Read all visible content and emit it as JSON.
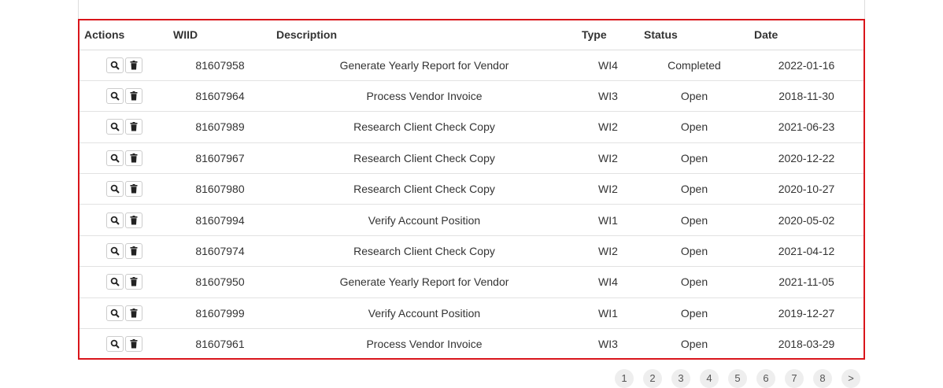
{
  "table": {
    "columns": [
      "Actions",
      "WIID",
      "Description",
      "Type",
      "Status",
      "Date"
    ],
    "rows": [
      {
        "wiid": "81607958",
        "description": "Generate Yearly Report for Vendor",
        "type": "WI4",
        "status": "Completed",
        "date": "2022-01-16"
      },
      {
        "wiid": "81607964",
        "description": "Process Vendor Invoice",
        "type": "WI3",
        "status": "Open",
        "date": "2018-11-30"
      },
      {
        "wiid": "81607989",
        "description": "Research Client Check Copy",
        "type": "WI2",
        "status": "Open",
        "date": "2021-06-23"
      },
      {
        "wiid": "81607967",
        "description": "Research Client Check Copy",
        "type": "WI2",
        "status": "Open",
        "date": "2020-12-22"
      },
      {
        "wiid": "81607980",
        "description": "Research Client Check Copy",
        "type": "WI2",
        "status": "Open",
        "date": "2020-10-27"
      },
      {
        "wiid": "81607994",
        "description": "Verify Account Position",
        "type": "WI1",
        "status": "Open",
        "date": "2020-05-02"
      },
      {
        "wiid": "81607974",
        "description": "Research Client Check Copy",
        "type": "WI2",
        "status": "Open",
        "date": "2021-04-12"
      },
      {
        "wiid": "81607950",
        "description": "Generate Yearly Report for Vendor",
        "type": "WI4",
        "status": "Open",
        "date": "2021-11-05"
      },
      {
        "wiid": "81607999",
        "description": "Verify Account Position",
        "type": "WI1",
        "status": "Open",
        "date": "2019-12-27"
      },
      {
        "wiid": "81607961",
        "description": "Process Vendor Invoice",
        "type": "WI3",
        "status": "Open",
        "date": "2018-03-29"
      }
    ]
  },
  "row_actions": [
    "search-icon",
    "trash-icon"
  ],
  "pagination": [
    "1",
    "2",
    "3",
    "4",
    "5",
    "6",
    "7",
    "8",
    ">"
  ],
  "colors": {
    "highlight_border": "#d9151b",
    "pager_bg": "#eeeeee"
  }
}
